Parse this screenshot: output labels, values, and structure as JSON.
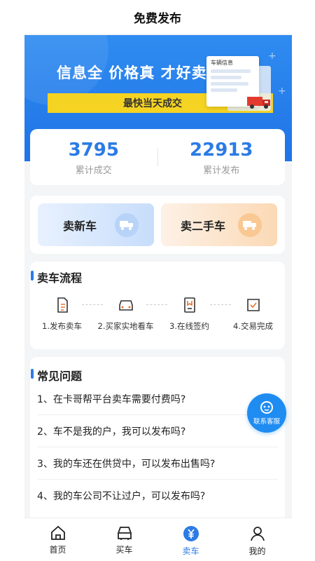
{
  "header": {
    "title": "免费发布"
  },
  "banner": {
    "slogan": "信息全 价格真 才好卖",
    "strip_text": "最快当天成交",
    "doc_title": "车辆信息"
  },
  "stats": [
    {
      "value": "3795",
      "label": "累计成交"
    },
    {
      "value": "22913",
      "label": "累计发布"
    }
  ],
  "sell": {
    "new_car": "卖新车",
    "used_car": "卖二手车"
  },
  "flow": {
    "title": "卖车流程",
    "steps": [
      {
        "label": "1.发布卖车",
        "icon": "document-icon"
      },
      {
        "label": "2.买家实地看车",
        "icon": "car-icon"
      },
      {
        "label": "3.在线签约",
        "icon": "contract-icon"
      },
      {
        "label": "4.交易完成",
        "icon": "check-box-icon"
      }
    ]
  },
  "faq": {
    "title": "常见问题",
    "items": [
      "1、在卡哥帮平台卖车需要付费吗?",
      "2、车不是我的户，我可以发布吗?",
      "3、我的车还在供贷中，可以发布出售吗?",
      "4、我的车公司不让过户，可以发布吗?"
    ]
  },
  "service": {
    "label": "联系客服"
  },
  "tabs": [
    {
      "label": "首页",
      "icon": "home-icon",
      "active": false
    },
    {
      "label": "买车",
      "icon": "car-front-icon",
      "active": false
    },
    {
      "label": "卖车",
      "icon": "yen-icon",
      "active": true
    },
    {
      "label": "我的",
      "icon": "user-icon",
      "active": false
    }
  ],
  "colors": {
    "accent": "#2c7be5",
    "banner": "#2a86ee",
    "strip": "#f5d322"
  }
}
